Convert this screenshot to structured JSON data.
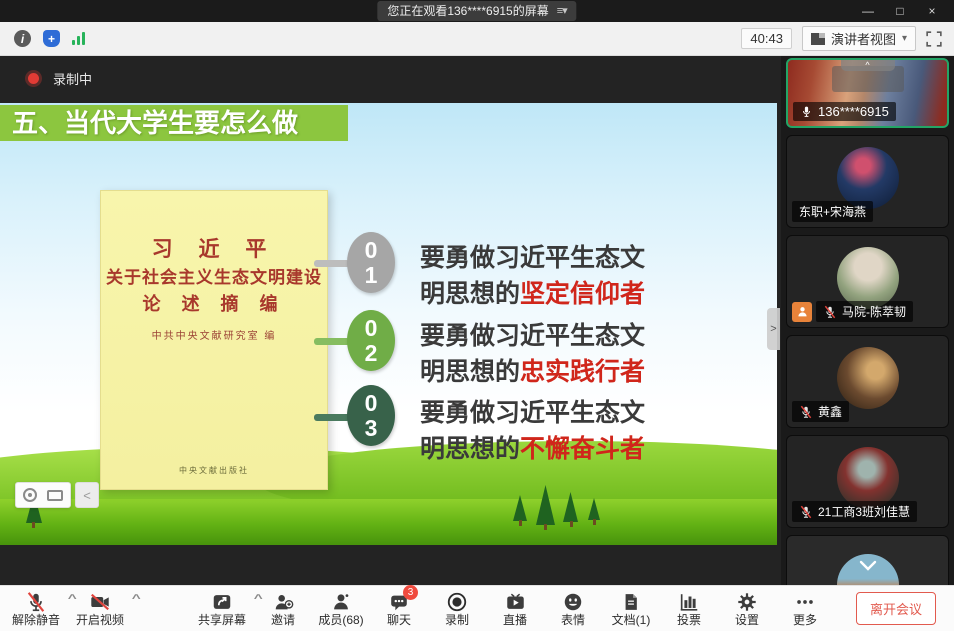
{
  "window": {
    "title": "您正在观看136****6915的屏幕",
    "controls": {
      "minimize": "—",
      "maximize": "□",
      "close": "×"
    }
  },
  "glyphs": {
    "menu": "≡",
    "dropdown": "▾",
    "caret_up": "^",
    "chevron_left": "<",
    "chevron_right": ">",
    "info": "i",
    "plus": "+"
  },
  "statusbar": {
    "timer": "40:43",
    "view_mode": "演讲者视图"
  },
  "recording": {
    "label": "录制中"
  },
  "slide": {
    "title": "五、当代大学生要怎么做",
    "banner_color": "#8cc63f",
    "highlight_color": "#d0261b",
    "book": {
      "title_line1": "习 近 平",
      "title_line2": "关于社会主义生态文明建设",
      "title_line3": "论 述 摘 编",
      "editor": "中共中央文献研究室 编",
      "publisher": "中央文献出版社"
    },
    "points": [
      {
        "digit_top": "0",
        "digit_bottom": "1",
        "circle_color": "#a6a6a6",
        "line1": "要勇做习近平生态文",
        "line2_prefix": "明思想的",
        "line2_highlight": "坚定信仰者"
      },
      {
        "digit_top": "0",
        "digit_bottom": "2",
        "circle_color": "#70ad47",
        "line1": "要勇做习近平生态文",
        "line2_prefix": "明思想的",
        "line2_highlight": "忠实践行者"
      },
      {
        "digit_top": "0",
        "digit_bottom": "3",
        "circle_color": "#38624a",
        "line1": "要勇做习近平生态文",
        "line2_prefix": "明思想的",
        "line2_highlight": "不懈奋斗者"
      }
    ]
  },
  "participants": {
    "tiles": [
      {
        "name": "136****6915",
        "status": "speaking"
      },
      {
        "name": "东职+宋海燕"
      },
      {
        "name": "马院-陈萃韧",
        "muted": true,
        "host_badge": true
      },
      {
        "name": "黄鑫",
        "muted": true
      },
      {
        "name": "21工商3班刘佳慧",
        "muted": true
      },
      {
        "name": ""
      }
    ]
  },
  "toolbar": {
    "items": [
      {
        "label": "解除静音"
      },
      {
        "label": "开启视频"
      },
      {
        "label": "共享屏幕"
      },
      {
        "label": "邀请"
      },
      {
        "label": "成员(68)"
      },
      {
        "label": "聊天"
      },
      {
        "label": "录制"
      },
      {
        "label": "直播"
      },
      {
        "label": "表情"
      },
      {
        "label": "文档(1)"
      },
      {
        "label": "投票"
      },
      {
        "label": "设置"
      },
      {
        "label": "更多"
      }
    ],
    "chat_badge": "3",
    "leave_label": "离开会议"
  }
}
